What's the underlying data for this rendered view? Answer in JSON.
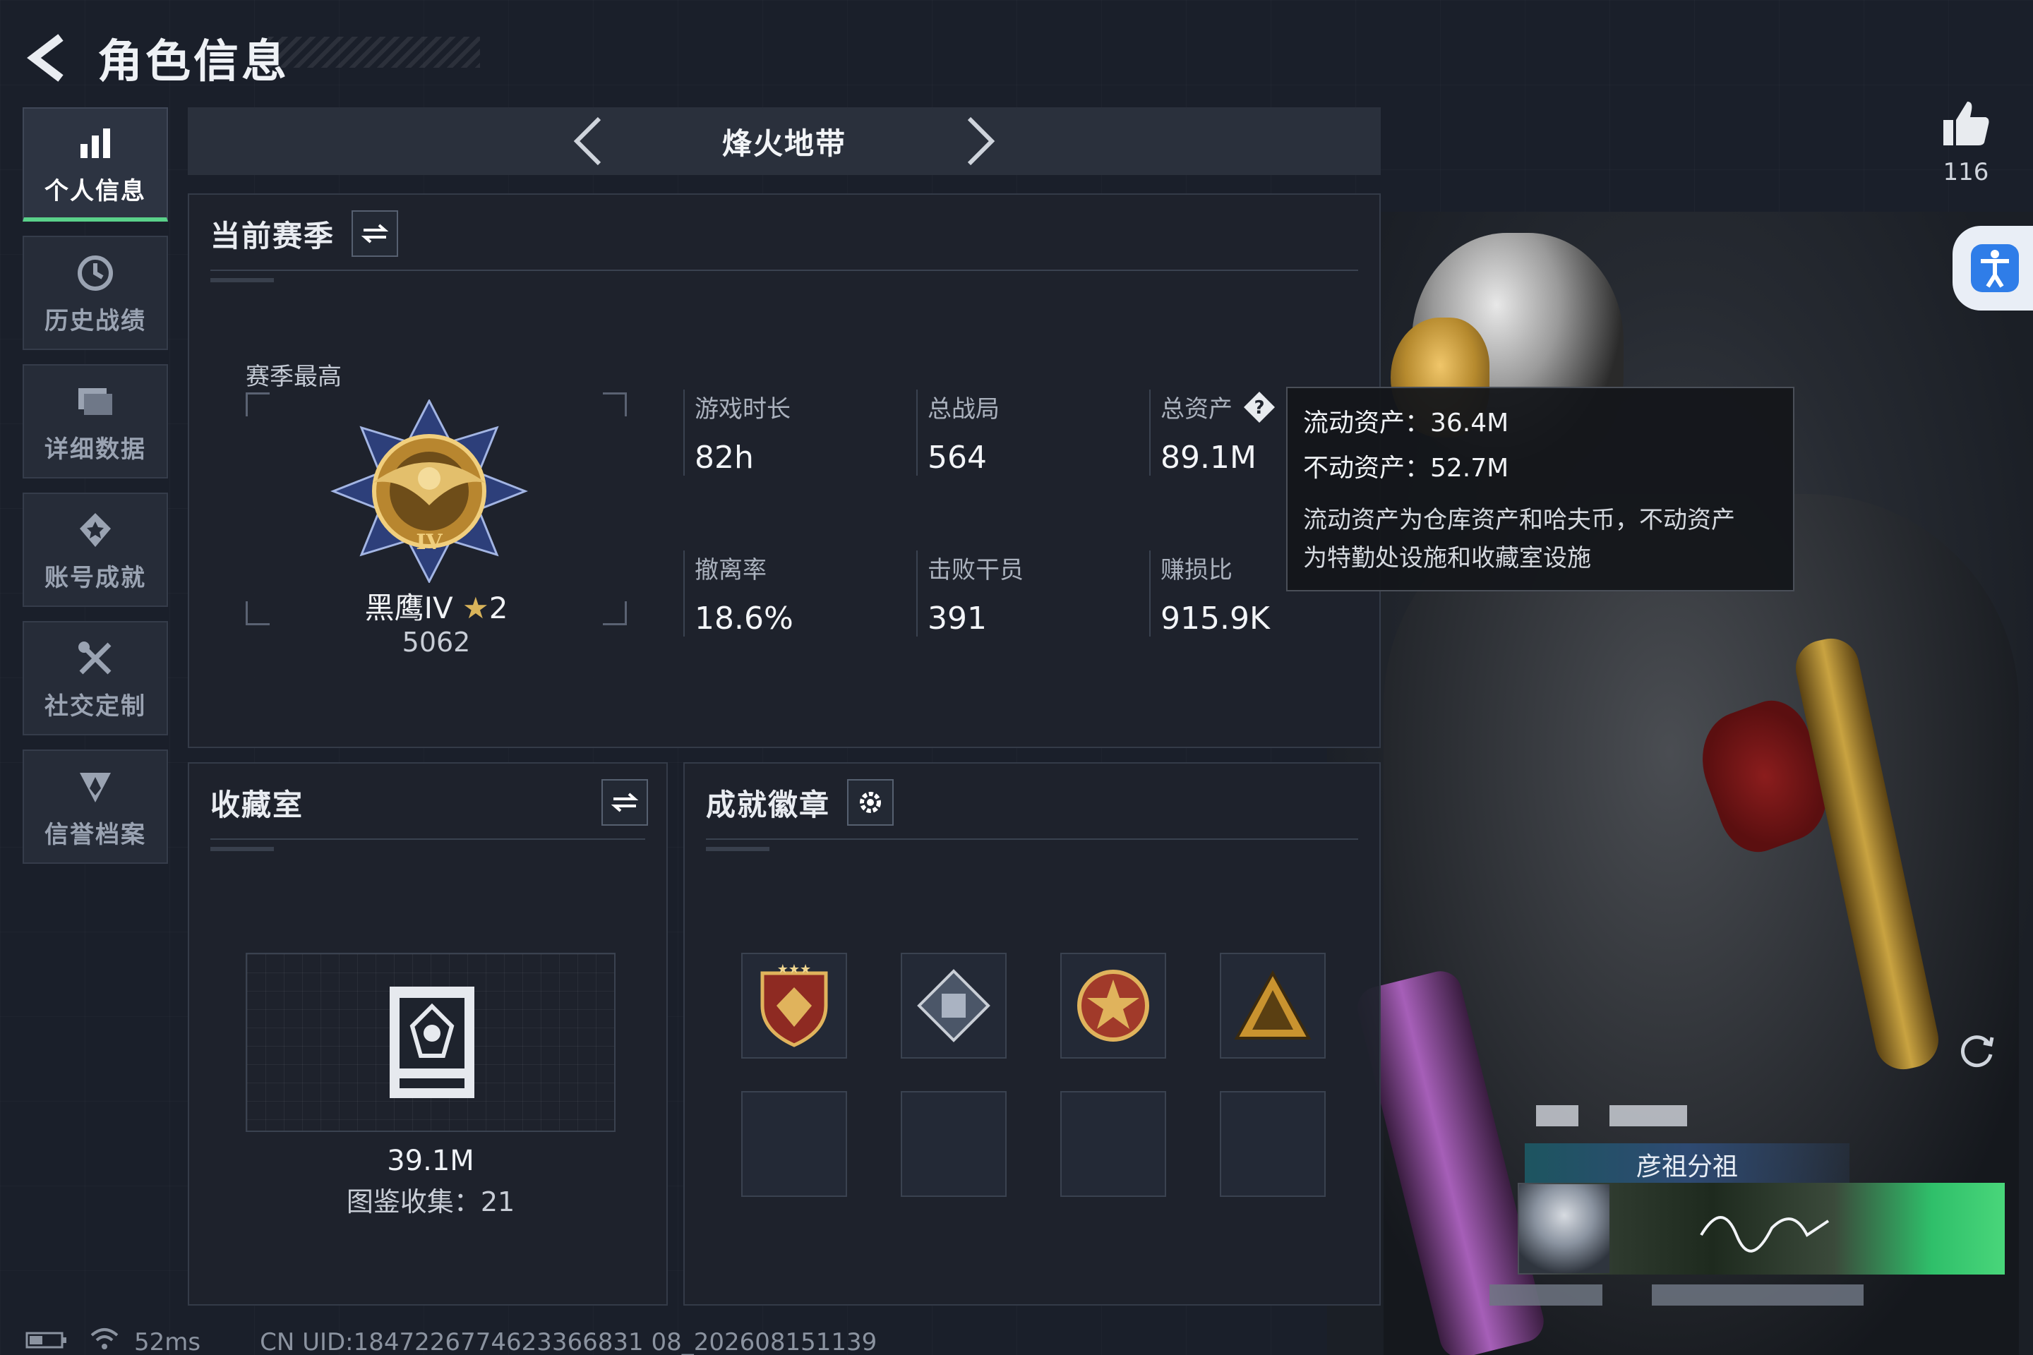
{
  "header": {
    "title": "角色信息"
  },
  "sidebar": {
    "items": [
      {
        "label": "个人信息",
        "icon": "bar-chart-icon",
        "active": true
      },
      {
        "label": "历史战绩",
        "icon": "history-clock-icon",
        "active": false
      },
      {
        "label": "详细数据",
        "icon": "folder-data-icon",
        "active": false
      },
      {
        "label": "账号成就",
        "icon": "achievement-medal-icon",
        "active": false
      },
      {
        "label": "社交定制",
        "icon": "tools-icon",
        "active": false
      },
      {
        "label": "信誉档案",
        "icon": "shield-badge-icon",
        "active": false
      }
    ]
  },
  "mode": {
    "title": "烽火地带"
  },
  "season": {
    "title": "当前赛季",
    "best_label": "赛季最高",
    "rank_name": "黑鹰IV",
    "rank_stars": "2",
    "rank_score": "5062",
    "stats": [
      {
        "label": "游戏时长",
        "value": "82h"
      },
      {
        "label": "总战局",
        "value": "564"
      },
      {
        "label": "总资产",
        "value": "89.1M",
        "help": true
      },
      {
        "label": "撤离率",
        "value": "18.6%"
      },
      {
        "label": "击败干员",
        "value": "391"
      },
      {
        "label": "赚损比",
        "value": "915.9K"
      }
    ]
  },
  "tooltip": {
    "liquid": "流动资产：36.4M",
    "fixed": "不动资产：52.7M",
    "desc_line1": "流动资产为仓库资产和哈夫币，不动资产",
    "desc_line2": "为特勤处设施和收藏室设施"
  },
  "collection": {
    "title": "收藏室",
    "value": "39.1M",
    "count": "图鉴收集：21"
  },
  "badges": {
    "title": "成就徽章",
    "items": [
      "badge-shield-stars-icon",
      "badge-diamond-icon",
      "badge-star-emblem-icon",
      "badge-warning-triangle-icon"
    ]
  },
  "social": {
    "like_count": "116",
    "team_name": "彦祖分祖"
  },
  "status": {
    "ping": "52ms",
    "uid": "CN UID:1847226774623366831 08_202608151139"
  },
  "colors": {
    "accent_green": "#5ad18a",
    "panel_bg": "#1e232d",
    "tooltip_bg": "#14161a",
    "gold": "#c9a341"
  }
}
